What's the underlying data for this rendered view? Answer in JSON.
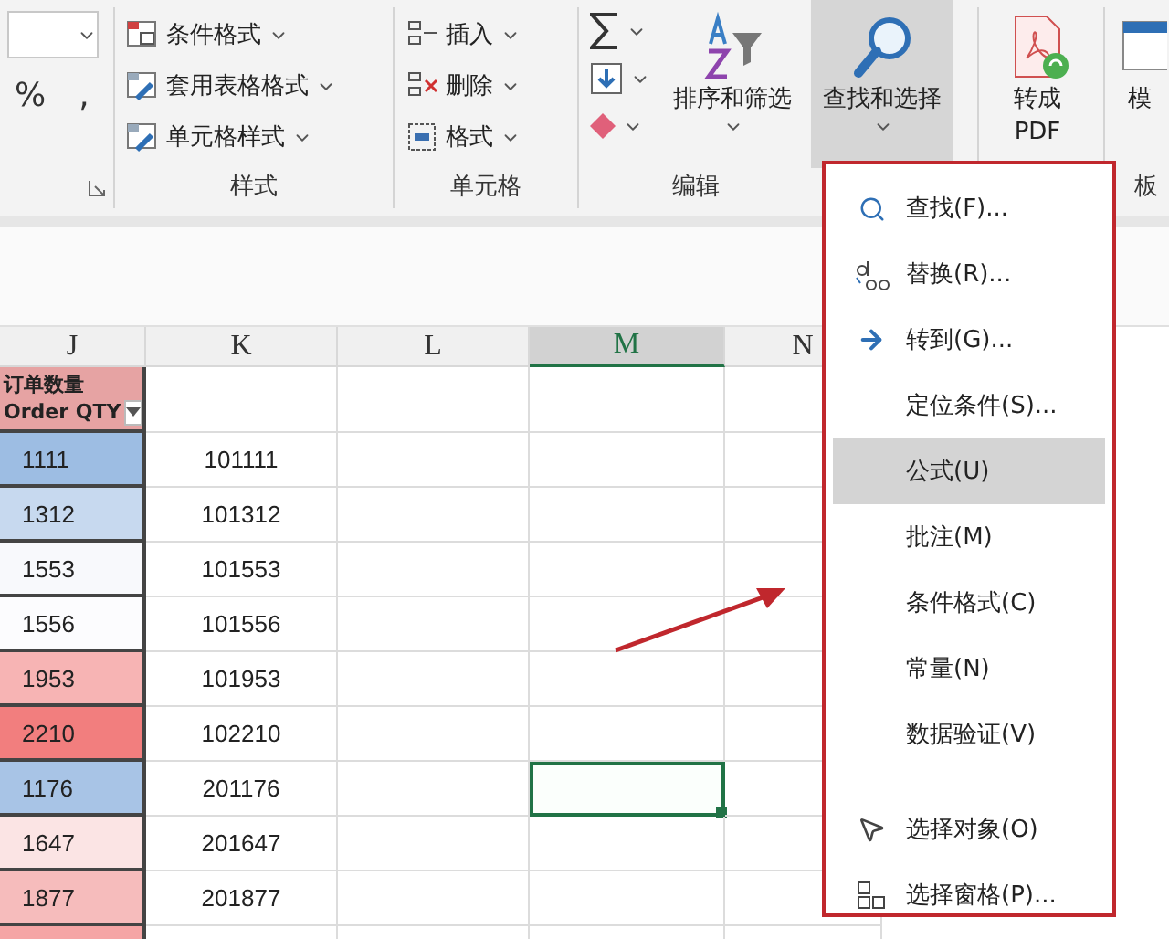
{
  "ribbon": {
    "groups": [
      {
        "kind": "number",
        "symbols": [
          "%",
          ","
        ]
      },
      {
        "kind": "list",
        "label": "样式",
        "items": [
          {
            "label": "条件格式"
          },
          {
            "label": "套用表格格式"
          },
          {
            "label": "单元格样式"
          }
        ]
      },
      {
        "kind": "list",
        "label": "单元格",
        "items": [
          {
            "label": "插入"
          },
          {
            "label": "删除"
          },
          {
            "label": "格式"
          }
        ]
      },
      {
        "kind": "editing",
        "label": "编辑",
        "buttons": [
          {
            "lines": [
              "排序和筛选"
            ],
            "selected": false
          },
          {
            "lines": [
              "查找和选择"
            ],
            "selected": true
          }
        ]
      },
      {
        "kind": "big",
        "buttons": [
          {
            "lines": [
              "转成",
              "PDF"
            ],
            "selected": false
          }
        ]
      },
      {
        "kind": "cut",
        "label": "板",
        "buttons": [
          {
            "lines": [
              "模"
            ],
            "selected": false
          }
        ]
      }
    ]
  },
  "sheet": {
    "columns": [
      {
        "label": "J",
        "selected": false
      },
      {
        "label": "K",
        "selected": false
      },
      {
        "label": "L",
        "selected": false
      },
      {
        "label": "M",
        "selected": true
      },
      {
        "label": "N",
        "selected": false
      }
    ],
    "header": {
      "title": "订单数量",
      "subtitle": "Order QTY"
    },
    "rows": [
      {
        "qty": "1111",
        "code": "101111",
        "color": "#9dbde3",
        "selected": false
      },
      {
        "qty": "1312",
        "code": "101312",
        "color": "#c7d9ef",
        "selected": false
      },
      {
        "qty": "1553",
        "code": "101553",
        "color": "#f8f9fc",
        "selected": false
      },
      {
        "qty": "1556",
        "code": "101556",
        "color": "#fcfcfe",
        "selected": false
      },
      {
        "qty": "1953",
        "code": "101953",
        "color": "#f7b4b4",
        "selected": false
      },
      {
        "qty": "2210",
        "code": "102210",
        "color": "#f27e7e",
        "selected": false
      },
      {
        "qty": "1176",
        "code": "201176",
        "color": "#a8c4e6",
        "selected": true
      },
      {
        "qty": "1647",
        "code": "201647",
        "color": "#fbe4e4",
        "selected": false
      },
      {
        "qty": "1877",
        "code": "201877",
        "color": "#f6bcbc",
        "selected": false
      },
      {
        "color": "#f5a5a5",
        "selected": false
      }
    ]
  },
  "menu": {
    "items": [
      {
        "kind": "icon",
        "label": "查找(F)...",
        "selected": false
      },
      {
        "kind": "icon",
        "label": "替换(R)...",
        "selected": false
      },
      {
        "kind": "icon",
        "label": "转到(G)...",
        "selected": false
      },
      {
        "kind": "plain",
        "label": "定位条件(S)...",
        "selected": false
      },
      {
        "kind": "plain",
        "label": "公式(U)",
        "selected": true
      },
      {
        "kind": "plain",
        "label": "批注(M)",
        "selected": false
      },
      {
        "kind": "plain",
        "label": "条件格式(C)",
        "selected": false
      },
      {
        "kind": "plain",
        "label": "常量(N)",
        "selected": false
      },
      {
        "kind": "plain",
        "label": "数据验证(V)",
        "selected": false
      },
      {
        "kind": "separator"
      },
      {
        "kind": "icon",
        "label": "选择对象(O)",
        "selected": false
      },
      {
        "kind": "icon",
        "label": "选择窗格(P)...",
        "selected": false
      }
    ]
  }
}
